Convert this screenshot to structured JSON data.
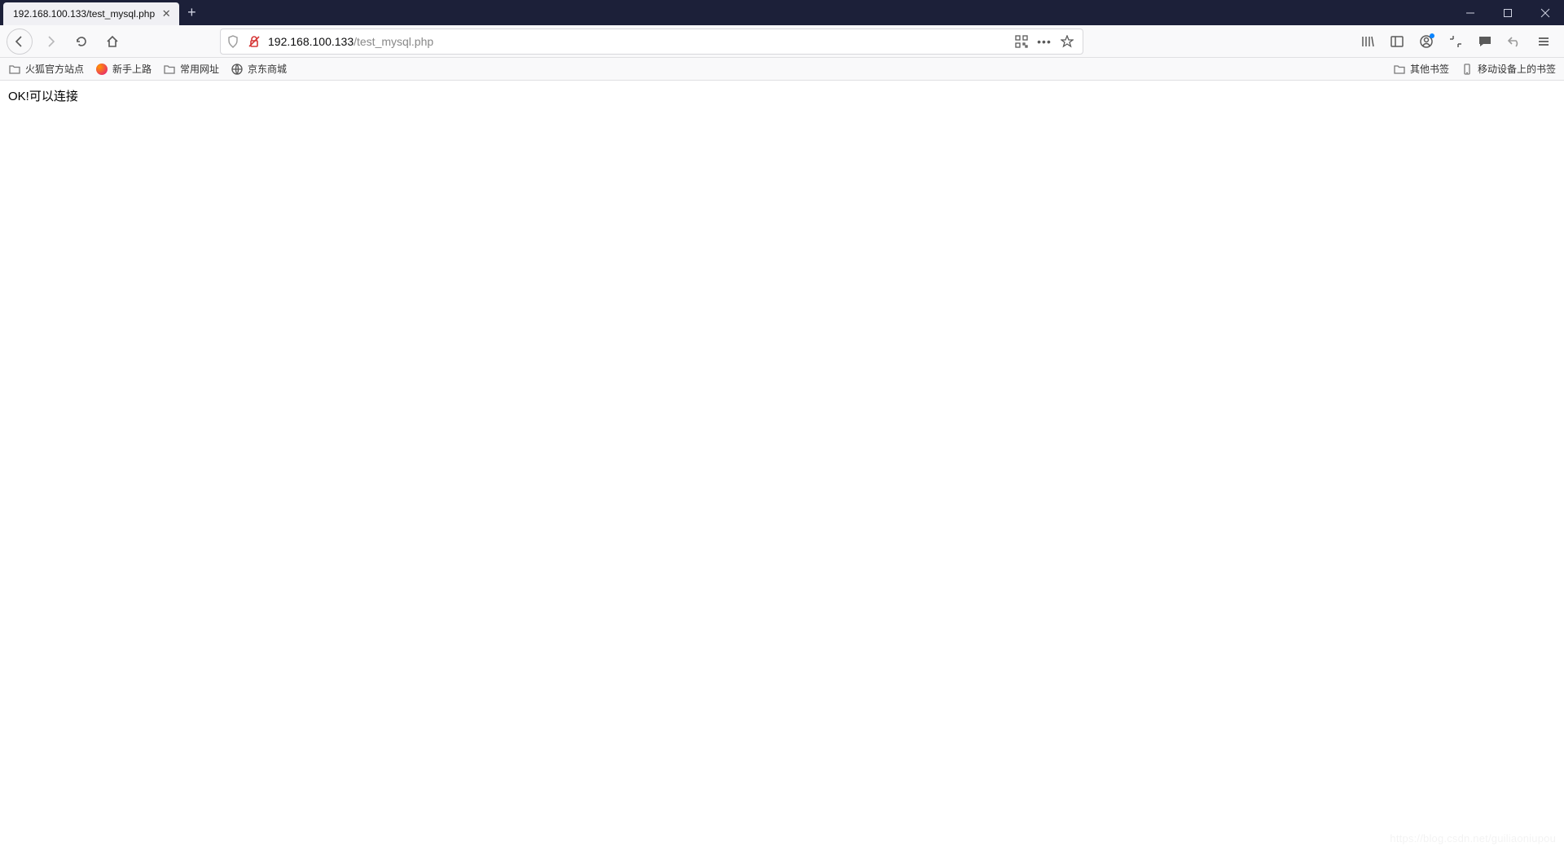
{
  "tab": {
    "title": "192.168.100.133/test_mysql.php"
  },
  "url": {
    "host": "192.168.100.133",
    "path": "/test_mysql.php"
  },
  "bookmarks": {
    "left": [
      {
        "label": "火狐官方站点",
        "icon": "folder"
      },
      {
        "label": "新手上路",
        "icon": "firefox"
      },
      {
        "label": "常用网址",
        "icon": "folder"
      },
      {
        "label": "京东商城",
        "icon": "jd"
      }
    ],
    "right": [
      {
        "label": "其他书签",
        "icon": "folder"
      },
      {
        "label": "移动设备上的书签",
        "icon": "mobile"
      }
    ]
  },
  "page": {
    "body_text": "OK!可以连接"
  },
  "watermark": "https://blog.csdn.net/guiliaoniupou"
}
